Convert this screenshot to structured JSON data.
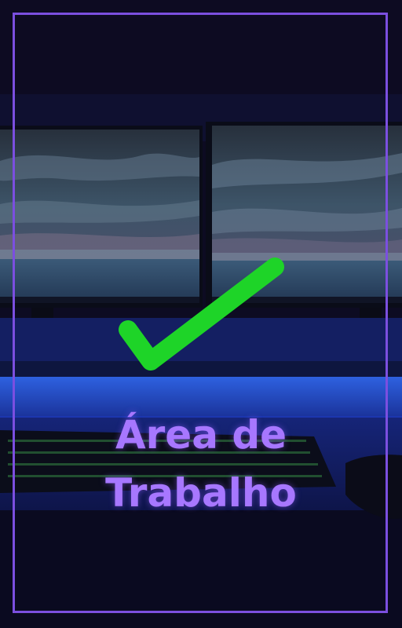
{
  "title": {
    "line1": "Área de",
    "line2": "Trabalho"
  },
  "colors": {
    "frame": "#7b4fe0",
    "title_text": "#a777ff",
    "checkmark": "#1ed428",
    "background": "#0d0b22"
  },
  "icons": {
    "checkmark": "check-icon"
  }
}
